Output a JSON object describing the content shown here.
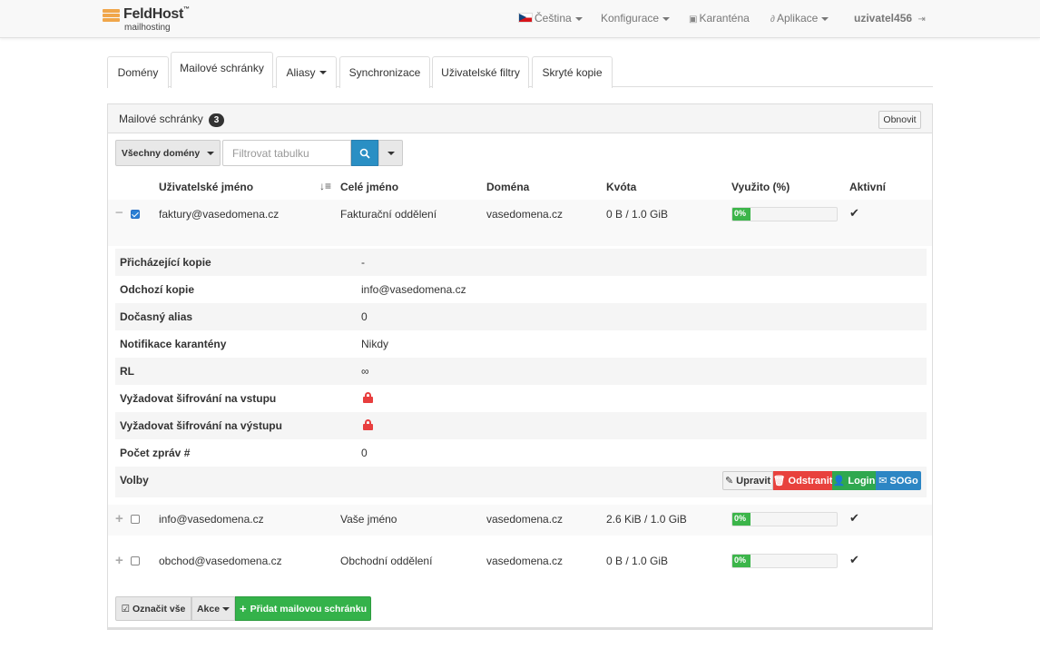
{
  "brand": {
    "name": "FeldHost",
    "tm": "™",
    "subtitle": "mailhosting"
  },
  "nav": {
    "language": "Čeština",
    "config": "Konfigurace",
    "quarantine": "Karanténa",
    "apps": "Aplikace",
    "user": "uzivatel456"
  },
  "tabs": [
    {
      "label": "Domény"
    },
    {
      "label": "Mailové schránky"
    },
    {
      "label": "Aliasy"
    },
    {
      "label": "Synchronizace"
    },
    {
      "label": "Uživatelské filtry"
    },
    {
      "label": "Skryté kopie"
    }
  ],
  "panel": {
    "title": "Mailové schránky",
    "count": "3",
    "refresh_label": "Obnovit"
  },
  "toolbar": {
    "domains_label": "Všechny domény",
    "filter_placeholder": "Filtrovat tabulku",
    "search_icon": "search-icon"
  },
  "columns": [
    "Uživatelské jméno",
    "Celé jméno",
    "Doména",
    "Kvóta",
    "Využito (%)",
    "Aktivní"
  ],
  "mailboxes": [
    {
      "username": "faktury@vasedomena.cz",
      "name": "Fakturační oddělení",
      "domain": "vasedomena.cz",
      "quota": "0 B / 1.0 GiB",
      "used": "0%",
      "active": "✔",
      "expanded": true,
      "checked": true
    },
    {
      "username": "info@vasedomena.cz",
      "name": "Vaše jméno",
      "domain": "vasedomena.cz",
      "quota": "2.6 KiB / 1.0 GiB",
      "used": "0%",
      "active": "✔",
      "expanded": false,
      "checked": false
    },
    {
      "username": "obchod@vasedomena.cz",
      "name": "Obchodní oddělení",
      "domain": "vasedomena.cz",
      "quota": "0 B / 1.0 GiB",
      "used": "0%",
      "active": "✔",
      "expanded": false,
      "checked": false
    }
  ],
  "details": {
    "incoming_copy": {
      "label": "Přicházející kopie",
      "value": "-"
    },
    "outgoing_copy": {
      "label": "Odchozí kopie",
      "value": "info@vasedomena.cz"
    },
    "temp_alias": {
      "label": "Dočasný alias",
      "value": "0"
    },
    "quarantine_notification": {
      "label": "Notifikace karantény",
      "value": "Nikdy"
    },
    "rl": {
      "label": "RL",
      "value": "∞"
    },
    "tls_in": {
      "label": "Vyžadovat šifrování na vstupu",
      "icon": "lock-icon"
    },
    "tls_out": {
      "label": "Vyžadovat šifrování na výstupu",
      "icon": "lock-icon"
    },
    "msg_count": {
      "label": "Počet zpráv #",
      "value": "0"
    },
    "options": {
      "label": "Volby"
    }
  },
  "actions": {
    "edit": "Upravit",
    "delete": "Odstranit",
    "login": "Login",
    "sogo": "SOGo"
  },
  "footer": {
    "select_all": "Označit vše",
    "actions": "Akce",
    "add": "Přidat mailovou schránku"
  },
  "colors": {
    "primary": "#2a8fc4",
    "success": "#34b24a",
    "danger": "#e8413d",
    "brand": "#f0a64a"
  }
}
